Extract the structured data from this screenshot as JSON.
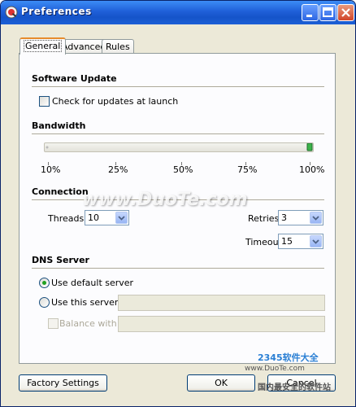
{
  "window": {
    "title": "Preferences",
    "controls": [
      "minimize-icon",
      "maximize-icon",
      "close-icon"
    ]
  },
  "tabs": [
    {
      "label": "General",
      "active": true
    },
    {
      "label": "Advanced",
      "active": false
    },
    {
      "label": "Rules",
      "active": false
    }
  ],
  "software_update": {
    "heading": "Software Update",
    "check_label": "Check for updates at launch",
    "checked": false
  },
  "bandwidth": {
    "heading": "Bandwidth",
    "ticks": [
      "10%",
      "25%",
      "50%",
      "75%",
      "100%"
    ],
    "value": "100%"
  },
  "connection": {
    "heading": "Connection",
    "threads_label": "Threads:",
    "threads_value": "10",
    "retries_label": "Retries:",
    "retries_value": "3",
    "timeout_label": "Timeout:",
    "timeout_value": "15"
  },
  "dns": {
    "heading": "DNS Server",
    "default_label": "Use default server",
    "this_label": "Use this server:",
    "server_value": "",
    "balance_label": "Balance with:",
    "balance_value": "",
    "selected": "default"
  },
  "buttons": {
    "factory": "Factory Settings",
    "ok": "OK",
    "cancel": "Cancel"
  },
  "watermarks": {
    "main": "www.DuoTe.com",
    "brand": "2345软件大全",
    "site": "www.DuoTe.com",
    "slogan": "国内最安全的软件站"
  },
  "colors": {
    "titlebar": "#1f5fd8",
    "tab_accent": "#e68b2c",
    "radio_dot": "#21a121"
  }
}
